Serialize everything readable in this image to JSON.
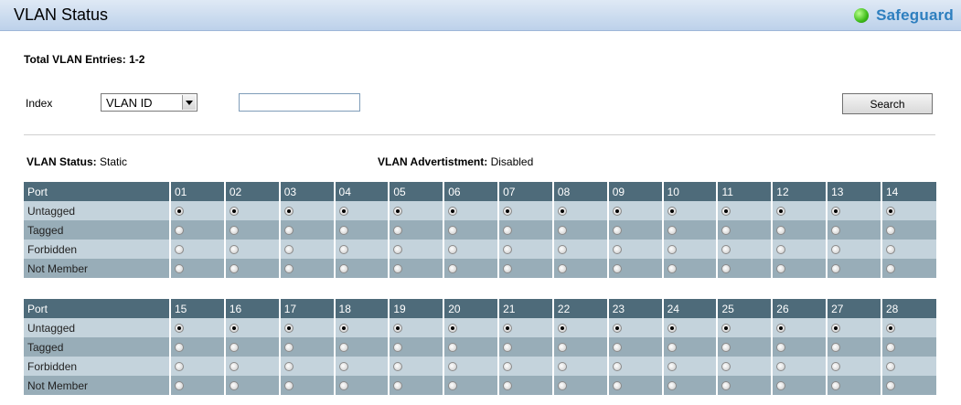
{
  "header": {
    "title": "VLAN Status",
    "brand": "Safeguard"
  },
  "entries_label": "Total VLAN Entries: 1-2",
  "search": {
    "index_label": "Index",
    "select_value": "VLAN ID",
    "input_value": "",
    "button_label": "Search"
  },
  "status": {
    "vlan_status_label": "VLAN Status:",
    "vlan_status_value": "Static",
    "advert_label": "VLAN Advertistment:",
    "advert_value": "Disabled"
  },
  "table1": {
    "port_header": "Port",
    "ports": [
      "01",
      "02",
      "03",
      "04",
      "05",
      "06",
      "07",
      "08",
      "09",
      "10",
      "11",
      "12",
      "13",
      "14"
    ],
    "rows": [
      {
        "label": "Untagged",
        "selected": true
      },
      {
        "label": "Tagged",
        "selected": false
      },
      {
        "label": "Forbidden",
        "selected": false
      },
      {
        "label": "Not Member",
        "selected": false
      }
    ]
  },
  "table2": {
    "port_header": "Port",
    "ports": [
      "15",
      "16",
      "17",
      "18",
      "19",
      "20",
      "21",
      "22",
      "23",
      "24",
      "25",
      "26",
      "27",
      "28"
    ],
    "rows": [
      {
        "label": "Untagged",
        "selected": true
      },
      {
        "label": "Tagged",
        "selected": false
      },
      {
        "label": "Forbidden",
        "selected": false
      },
      {
        "label": "Not Member",
        "selected": false
      }
    ]
  }
}
